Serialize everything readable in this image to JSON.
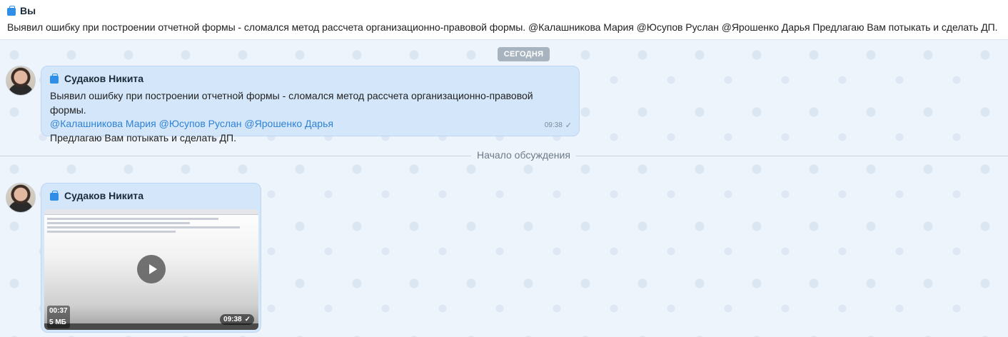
{
  "pinned": {
    "author": "Вы",
    "text": "Выявил ошибку при построении отчетной формы - сломался метод рассчета организационно-правовой формы. @Калашникова Мария @Юсупов Руслан @Ярошенко Дарья Предлагаю Вам потыкать и сделать ДП."
  },
  "date_separator": "СЕГОДНЯ",
  "messages": [
    {
      "sender": "Судаков Никита",
      "line1": "Выявил ошибку при построении отчетной формы - сломался метод рассчета организационно-правовой формы.",
      "mentions": [
        "@Калашникова Мария",
        "@Юсупов Руслан",
        "@Ярошенко Дарья"
      ],
      "line3": "Предлагаю Вам потыкать и сделать ДП.",
      "time": "09:38",
      "check": "✓"
    },
    {
      "sender": "Судаков Никита",
      "video_duration": "00:37",
      "video_size": "5 МБ",
      "time": "09:38",
      "check": "✓"
    }
  ],
  "thread_divider": "Начало обсуждения",
  "icons": {
    "sender_badge": "briefcase-icon",
    "play": "play-icon",
    "read": "check-icon"
  },
  "colors": {
    "accent": "#2f8fe6",
    "mention": "#2f82d6",
    "bubble": "#d3e6fa"
  }
}
